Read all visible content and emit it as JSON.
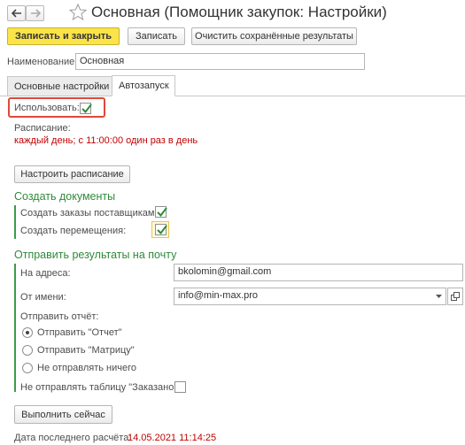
{
  "header": {
    "title": "Основная (Помощник закупок: Настройки)"
  },
  "toolbar": {
    "save_close": "Записать и закрыть",
    "save": "Записать",
    "clear_results": "Очистить сохранённые результаты"
  },
  "name_field": {
    "label": "Наименование:",
    "value": "Основная"
  },
  "tabs": [
    {
      "label": "Основные настройки"
    },
    {
      "label": "Автозапуск"
    }
  ],
  "autorun": {
    "use_label": "Использовать:",
    "use_checked": true,
    "schedule_label": "Расписание:",
    "schedule_text": "каждый день; с 11:00:00 один раз в день",
    "configure_schedule": "Настроить расписание"
  },
  "create_docs": {
    "heading": "Создать документы",
    "orders_label": "Создать заказы поставщикам:",
    "orders_checked": true,
    "moves_label": "Создать перемещения:",
    "moves_checked": true
  },
  "email": {
    "heading": "Отправить результаты на почту",
    "to_label": "На адреса:",
    "to_value": "bkolomin@gmail.com",
    "from_label": "От имени:",
    "from_value": "info@min-max.pro",
    "report_label": "Отправить отчёт:",
    "options": [
      {
        "label": "Отправить \"Отчет\"",
        "selected": true
      },
      {
        "label": "Отправить \"Матрицу\"",
        "selected": false
      },
      {
        "label": "Не отправлять ничего",
        "selected": false
      }
    ],
    "no_ordered_label": "Не отправлять таблицу \"Заказано\":",
    "no_ordered_checked": false
  },
  "run_now": "Выполнить сейчас",
  "last_calc": {
    "label": "Дата последнего расчёта:",
    "value": "14.05.2021 11:14:25"
  },
  "colors": {
    "primary": "#fbe34a",
    "heading_green": "#2e8b3a",
    "schedule_red": "#c00000",
    "highlight_red": "#e0483a"
  }
}
